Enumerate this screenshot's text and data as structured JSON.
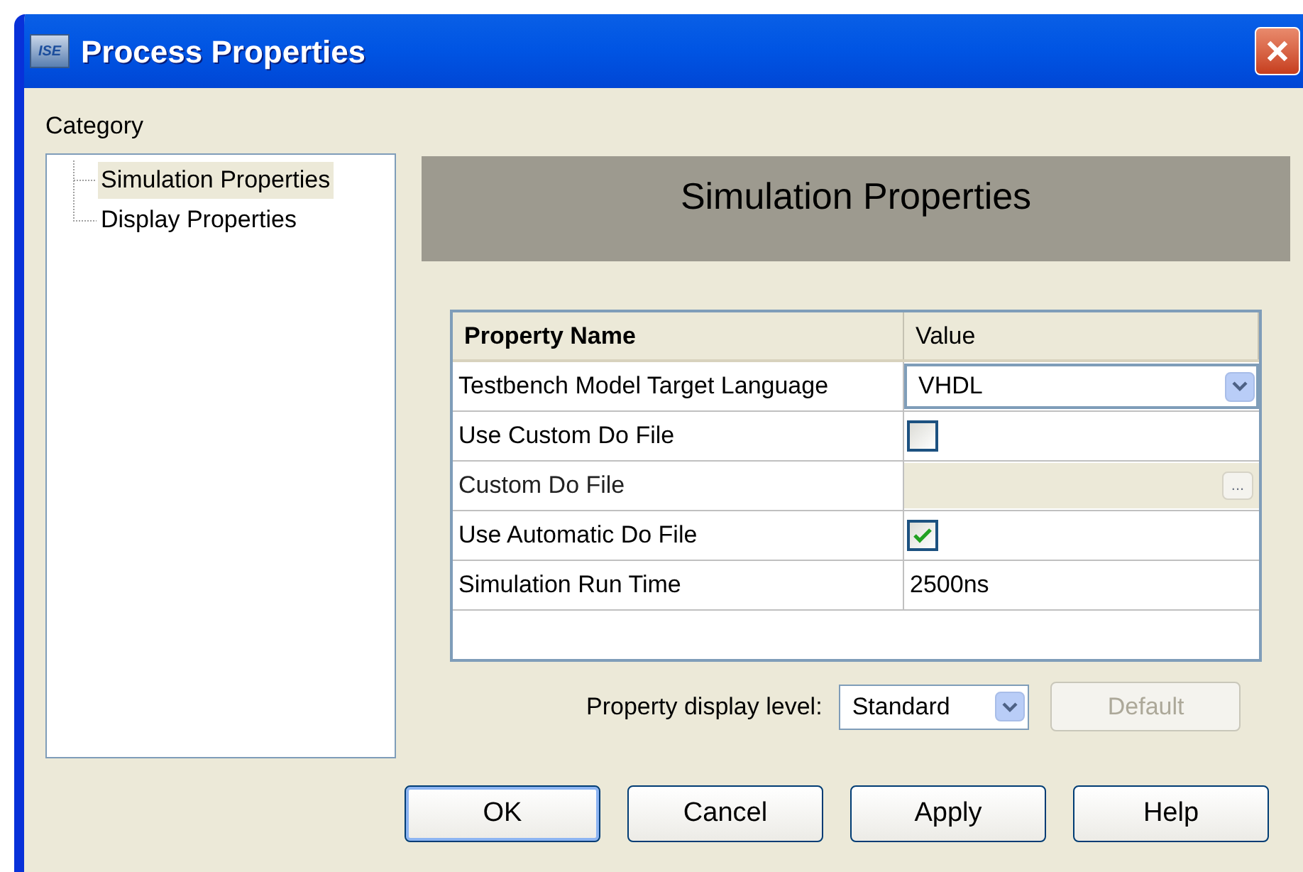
{
  "window": {
    "title": "Process Properties",
    "app_icon_text": "ISE"
  },
  "category": {
    "label": "Category",
    "items": [
      {
        "label": "Simulation Properties",
        "selected": true
      },
      {
        "label": "Display Properties",
        "selected": false
      }
    ]
  },
  "panel_title": "Simulation Properties",
  "table": {
    "columns": [
      "Property Name",
      "Value"
    ],
    "rows": [
      {
        "name": "Testbench Model Target Language",
        "kind": "dropdown",
        "value": "VHDL",
        "disabled": false
      },
      {
        "name": "Use Custom Do File",
        "kind": "checkbox",
        "checked": false,
        "disabled": false
      },
      {
        "name": "Custom Do File",
        "kind": "browse",
        "browse_label": "...",
        "disabled": true
      },
      {
        "name": "Use Automatic Do File",
        "kind": "checkbox",
        "checked": true,
        "disabled": false
      },
      {
        "name": "Simulation Run Time",
        "kind": "text",
        "value": "2500ns",
        "disabled": false
      }
    ]
  },
  "display_level": {
    "label": "Property display level:",
    "value": "Standard"
  },
  "default_button": {
    "label": "Default",
    "disabled": true
  },
  "buttons": [
    {
      "label": "OK",
      "selected": true
    },
    {
      "label": "Cancel",
      "selected": false
    },
    {
      "label": "Apply",
      "selected": false
    },
    {
      "label": "Help",
      "selected": false
    }
  ]
}
